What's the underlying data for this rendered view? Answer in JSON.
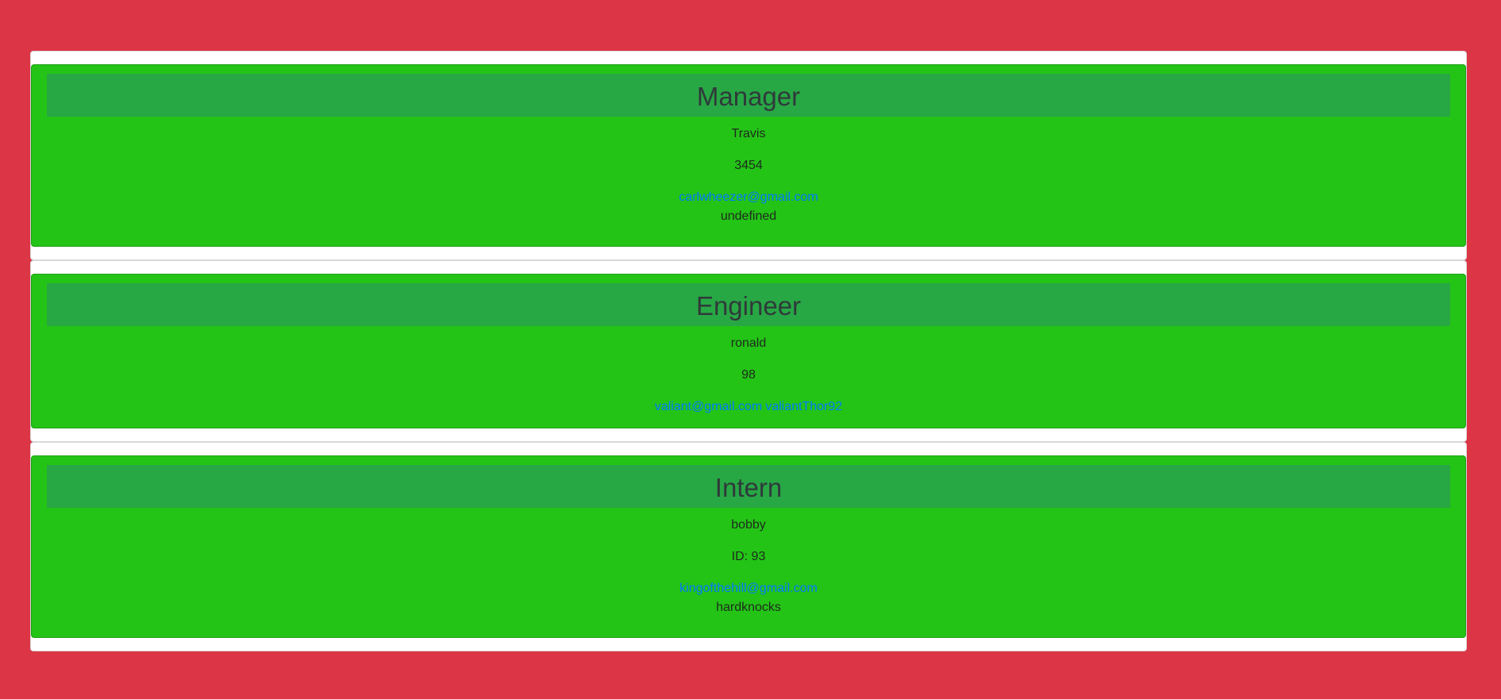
{
  "cards": [
    {
      "role": "Manager",
      "name": "Travis",
      "id": "3454",
      "email": "carlwheezer@gmail.com",
      "extra": "undefined"
    },
    {
      "role": "Engineer",
      "name": "ronald",
      "id": "98",
      "email": "valiant@gmail.com",
      "github": "valiantThor92"
    },
    {
      "role": "Intern",
      "name": "bobby",
      "id": "ID: 93",
      "email": "kingofthehill@gmail.com",
      "extra": "hardknocks"
    }
  ],
  "colors": {
    "page_background": "#dc3545",
    "card_background": "#23c416",
    "card_header_background": "#28a745",
    "link": "#007bff"
  }
}
